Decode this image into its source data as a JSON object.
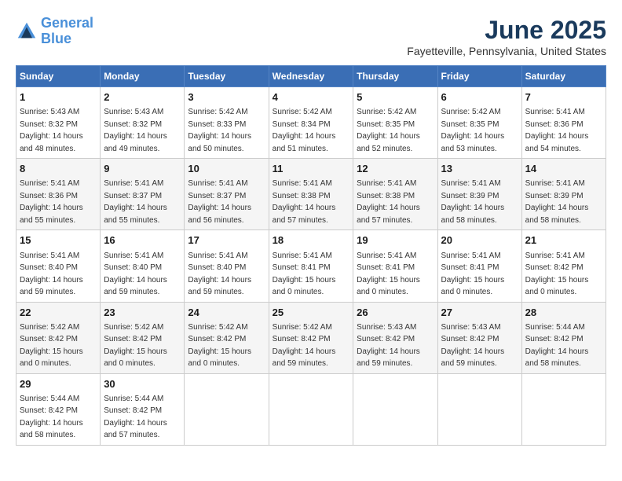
{
  "logo": {
    "line1": "General",
    "line2": "Blue"
  },
  "title": "June 2025",
  "location": "Fayetteville, Pennsylvania, United States",
  "weekdays": [
    "Sunday",
    "Monday",
    "Tuesday",
    "Wednesday",
    "Thursday",
    "Friday",
    "Saturday"
  ],
  "weeks": [
    [
      {
        "day": "1",
        "sunrise": "5:43 AM",
        "sunset": "8:32 PM",
        "daylight": "14 hours and 48 minutes."
      },
      {
        "day": "2",
        "sunrise": "5:43 AM",
        "sunset": "8:32 PM",
        "daylight": "14 hours and 49 minutes."
      },
      {
        "day": "3",
        "sunrise": "5:42 AM",
        "sunset": "8:33 PM",
        "daylight": "14 hours and 50 minutes."
      },
      {
        "day": "4",
        "sunrise": "5:42 AM",
        "sunset": "8:34 PM",
        "daylight": "14 hours and 51 minutes."
      },
      {
        "day": "5",
        "sunrise": "5:42 AM",
        "sunset": "8:35 PM",
        "daylight": "14 hours and 52 minutes."
      },
      {
        "day": "6",
        "sunrise": "5:42 AM",
        "sunset": "8:35 PM",
        "daylight": "14 hours and 53 minutes."
      },
      {
        "day": "7",
        "sunrise": "5:41 AM",
        "sunset": "8:36 PM",
        "daylight": "14 hours and 54 minutes."
      }
    ],
    [
      {
        "day": "8",
        "sunrise": "5:41 AM",
        "sunset": "8:36 PM",
        "daylight": "14 hours and 55 minutes."
      },
      {
        "day": "9",
        "sunrise": "5:41 AM",
        "sunset": "8:37 PM",
        "daylight": "14 hours and 55 minutes."
      },
      {
        "day": "10",
        "sunrise": "5:41 AM",
        "sunset": "8:37 PM",
        "daylight": "14 hours and 56 minutes."
      },
      {
        "day": "11",
        "sunrise": "5:41 AM",
        "sunset": "8:38 PM",
        "daylight": "14 hours and 57 minutes."
      },
      {
        "day": "12",
        "sunrise": "5:41 AM",
        "sunset": "8:38 PM",
        "daylight": "14 hours and 57 minutes."
      },
      {
        "day": "13",
        "sunrise": "5:41 AM",
        "sunset": "8:39 PM",
        "daylight": "14 hours and 58 minutes."
      },
      {
        "day": "14",
        "sunrise": "5:41 AM",
        "sunset": "8:39 PM",
        "daylight": "14 hours and 58 minutes."
      }
    ],
    [
      {
        "day": "15",
        "sunrise": "5:41 AM",
        "sunset": "8:40 PM",
        "daylight": "14 hours and 59 minutes."
      },
      {
        "day": "16",
        "sunrise": "5:41 AM",
        "sunset": "8:40 PM",
        "daylight": "14 hours and 59 minutes."
      },
      {
        "day": "17",
        "sunrise": "5:41 AM",
        "sunset": "8:40 PM",
        "daylight": "14 hours and 59 minutes."
      },
      {
        "day": "18",
        "sunrise": "5:41 AM",
        "sunset": "8:41 PM",
        "daylight": "15 hours and 0 minutes."
      },
      {
        "day": "19",
        "sunrise": "5:41 AM",
        "sunset": "8:41 PM",
        "daylight": "15 hours and 0 minutes."
      },
      {
        "day": "20",
        "sunrise": "5:41 AM",
        "sunset": "8:41 PM",
        "daylight": "15 hours and 0 minutes."
      },
      {
        "day": "21",
        "sunrise": "5:41 AM",
        "sunset": "8:42 PM",
        "daylight": "15 hours and 0 minutes."
      }
    ],
    [
      {
        "day": "22",
        "sunrise": "5:42 AM",
        "sunset": "8:42 PM",
        "daylight": "15 hours and 0 minutes."
      },
      {
        "day": "23",
        "sunrise": "5:42 AM",
        "sunset": "8:42 PM",
        "daylight": "15 hours and 0 minutes."
      },
      {
        "day": "24",
        "sunrise": "5:42 AM",
        "sunset": "8:42 PM",
        "daylight": "15 hours and 0 minutes."
      },
      {
        "day": "25",
        "sunrise": "5:42 AM",
        "sunset": "8:42 PM",
        "daylight": "14 hours and 59 minutes."
      },
      {
        "day": "26",
        "sunrise": "5:43 AM",
        "sunset": "8:42 PM",
        "daylight": "14 hours and 59 minutes."
      },
      {
        "day": "27",
        "sunrise": "5:43 AM",
        "sunset": "8:42 PM",
        "daylight": "14 hours and 59 minutes."
      },
      {
        "day": "28",
        "sunrise": "5:44 AM",
        "sunset": "8:42 PM",
        "daylight": "14 hours and 58 minutes."
      }
    ],
    [
      {
        "day": "29",
        "sunrise": "5:44 AM",
        "sunset": "8:42 PM",
        "daylight": "14 hours and 58 minutes."
      },
      {
        "day": "30",
        "sunrise": "5:44 AM",
        "sunset": "8:42 PM",
        "daylight": "14 hours and 57 minutes."
      },
      null,
      null,
      null,
      null,
      null
    ]
  ]
}
